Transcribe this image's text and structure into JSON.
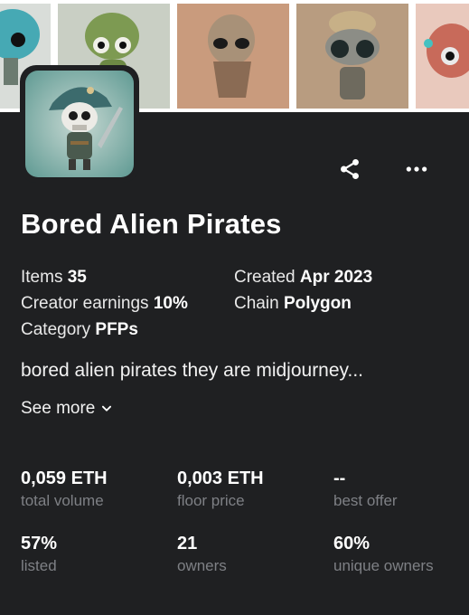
{
  "collection": {
    "name": "Bored Alien Pirates",
    "description": "bored alien pirates they are midjourney...",
    "see_more": "See more"
  },
  "details": {
    "items_label": "Items",
    "items_value": "35",
    "created_label": "Created",
    "created_value": "Apr 2023",
    "earnings_label": "Creator earnings",
    "earnings_value": "10%",
    "chain_label": "Chain",
    "chain_value": "Polygon",
    "category_label": "Category",
    "category_value": "PFPs"
  },
  "stats": [
    {
      "value": "0,059 ETH",
      "label": "total volume"
    },
    {
      "value": "0,003 ETH",
      "label": "floor price"
    },
    {
      "value": "--",
      "label": "best offer"
    },
    {
      "value": "57%",
      "label": "listed"
    },
    {
      "value": "21",
      "label": "owners"
    },
    {
      "value": "60%",
      "label": "unique owners"
    }
  ],
  "actions": {
    "share_icon": "share-icon",
    "more_icon": "more-horizontal-icon"
  },
  "colors": {
    "background": "#1f2022",
    "text": "#ffffff",
    "muted": "#7e8085"
  }
}
